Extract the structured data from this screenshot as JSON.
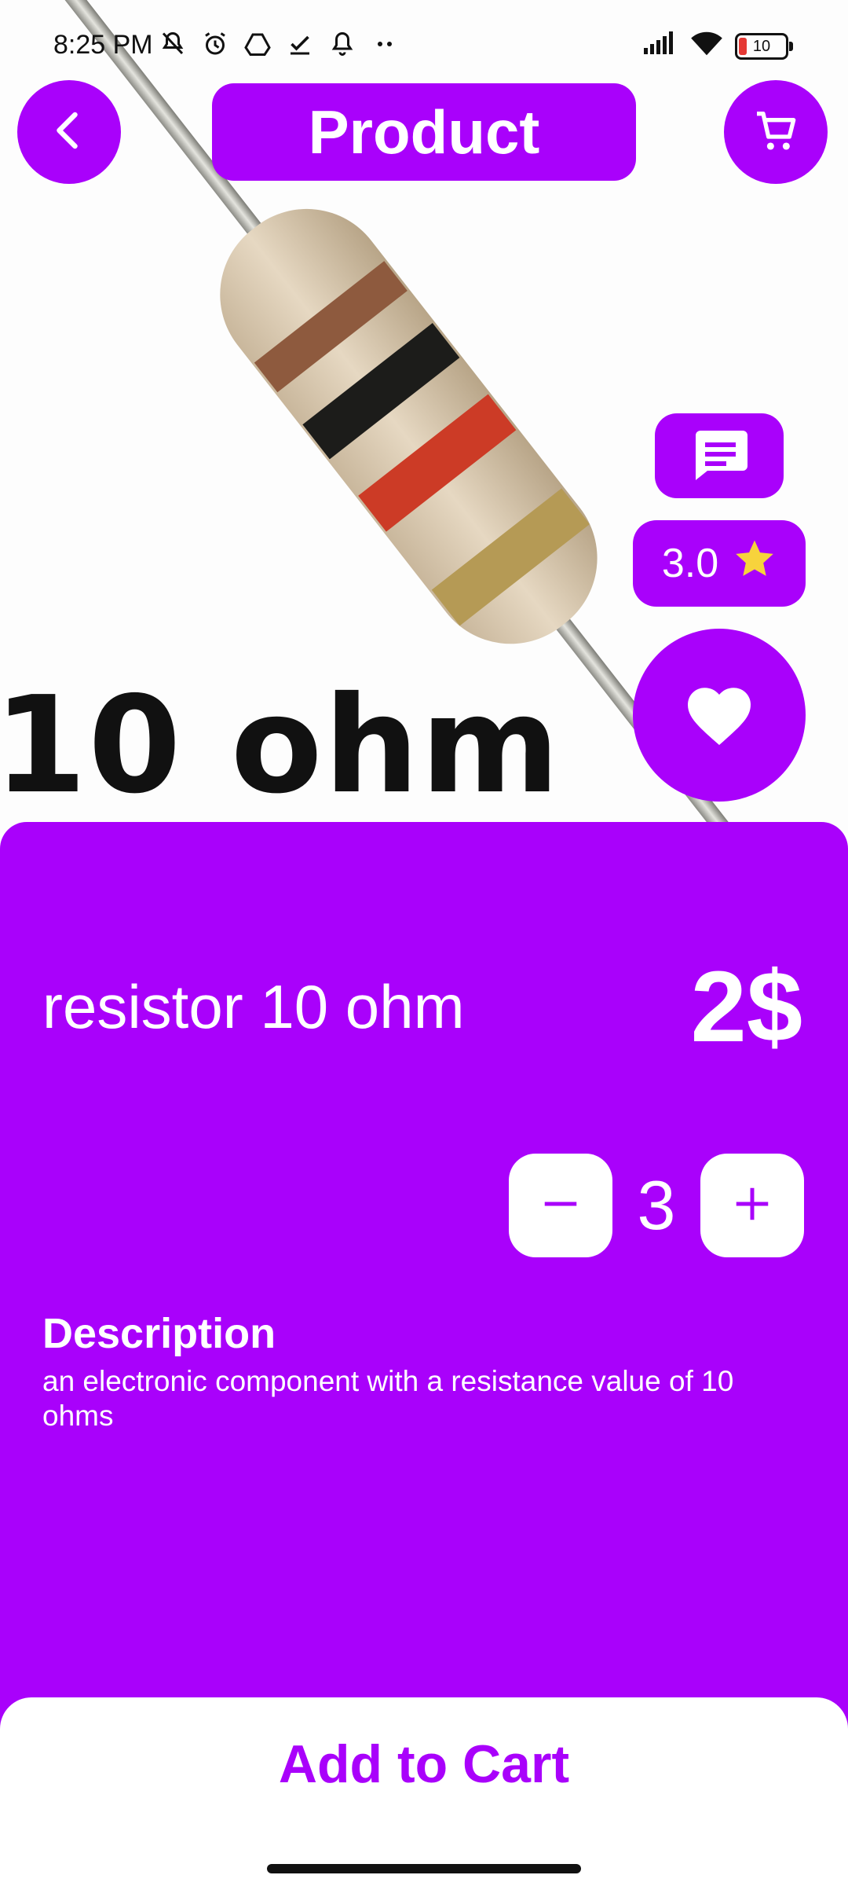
{
  "status_bar": {
    "time": "8:25 PM",
    "battery": "10",
    "left_icons": [
      "mute-icon",
      "alarm-icon",
      "drive-icon",
      "check-icon",
      "bell-icon",
      "more-dots-icon"
    ],
    "right_icons": [
      "signal-icon",
      "wifi-icon",
      "battery-icon"
    ]
  },
  "header": {
    "title": "Product"
  },
  "hero": {
    "caption": "10 ohm"
  },
  "actions": {
    "rating": "3.0"
  },
  "product": {
    "name": "resistor 10 ohm",
    "price": "2$",
    "quantity": "3",
    "description_heading": "Description",
    "description": "an electronic component with a resistance value of 10 ohms"
  },
  "footer": {
    "add_to_cart_label": "Add to Cart"
  },
  "colors": {
    "accent": "#a901fb",
    "star": "#f7d33c",
    "background": "#ffffff"
  }
}
